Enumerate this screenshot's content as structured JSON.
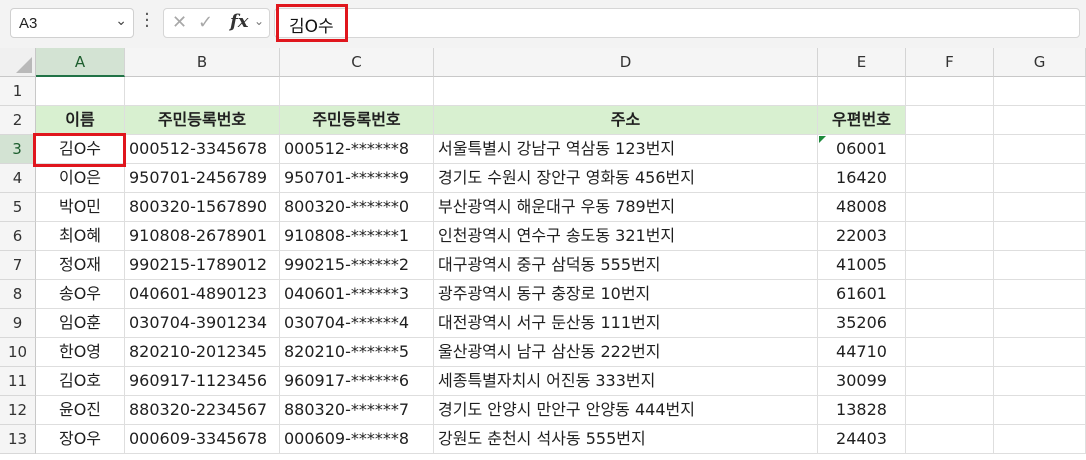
{
  "name_box": {
    "value": "A3"
  },
  "formula_bar": {
    "fx_label": "fx",
    "content": "김O수"
  },
  "columns": [
    "A",
    "B",
    "C",
    "D",
    "E",
    "F",
    "G"
  ],
  "rows": [
    "1",
    "2",
    "3",
    "4",
    "5",
    "6",
    "7",
    "8",
    "9",
    "10",
    "11",
    "12",
    "13"
  ],
  "selected_cell": "A3",
  "header_row": [
    "이름",
    "주민등록번호",
    "주민등록번호",
    "주소",
    "우편번호"
  ],
  "data_rows": [
    [
      "김O수",
      "000512-3345678",
      "000512-******8",
      "서울특별시 강남구 역삼동 123번지",
      "06001"
    ],
    [
      "이O은",
      "950701-2456789",
      "950701-******9",
      "경기도 수원시 장안구 영화동 456번지",
      "16420"
    ],
    [
      "박O민",
      "800320-1567890",
      "800320-******0",
      "부산광역시 해운대구 우동 789번지",
      "48008"
    ],
    [
      "최O혜",
      "910808-2678901",
      "910808-******1",
      "인천광역시 연수구 송도동 321번지",
      "22003"
    ],
    [
      "정O재",
      "990215-1789012",
      "990215-******2",
      "대구광역시 중구 삼덕동 555번지",
      "41005"
    ],
    [
      "송O우",
      "040601-4890123",
      "040601-******3",
      "광주광역시 동구 충장로 10번지",
      "61601"
    ],
    [
      "임O훈",
      "030704-3901234",
      "030704-******4",
      "대전광역시 서구 둔산동 111번지",
      "35206"
    ],
    [
      "한O영",
      "820210-2012345",
      "820210-******5",
      "울산광역시 남구 삼산동 222번지",
      "44710"
    ],
    [
      "김O호",
      "960917-1123456",
      "960917-******6",
      "세종특별자치시 어진동 333번지",
      "30099"
    ],
    [
      "윤O진",
      "880320-2234567",
      "880320-******7",
      "경기도 안양시 만안구 안양동 444번지",
      "13828"
    ],
    [
      "장O우",
      "000609-3345678",
      "000609-******8",
      "강원도 춘천시 석사동 555번지",
      "24403"
    ]
  ],
  "colors": {
    "header_fill": "#d8f0d0",
    "highlight": "#e0161d",
    "selection": "#217346"
  }
}
